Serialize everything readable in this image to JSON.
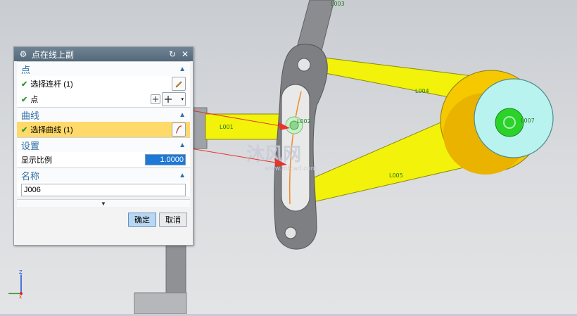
{
  "dialog": {
    "title": "点在线上副",
    "sections": {
      "point": {
        "header": "点",
        "select_link_label": "选择连杆 (1)",
        "point_label": "点"
      },
      "curve": {
        "header": "曲线",
        "select_curve_label": "选择曲线 (1)"
      },
      "settings": {
        "header": "设置",
        "display_scale_label": "显示比例",
        "display_scale_value": "1.0000"
      },
      "name": {
        "header": "名称",
        "name_value": "J006"
      }
    },
    "buttons": {
      "ok": "确定",
      "cancel": "取消"
    }
  },
  "viewport": {
    "labels": {
      "l001": "L001",
      "l002": "L002",
      "l003": "L003",
      "l004": "L004",
      "l005": "L005",
      "l007": "L007"
    },
    "watermark": {
      "main": "沐风网",
      "url": "www.mfcad.com"
    },
    "triad": {
      "z": "Z",
      "x": "X"
    }
  },
  "colors": {
    "link_yellow": "#f2f20a",
    "slot_link_gray": "#7d7f83",
    "disk_cyan": "#b9f3ef",
    "hub_green": "#2ad22a",
    "arrow_red": "#e8332e",
    "dialog_title": "#5d7282"
  }
}
